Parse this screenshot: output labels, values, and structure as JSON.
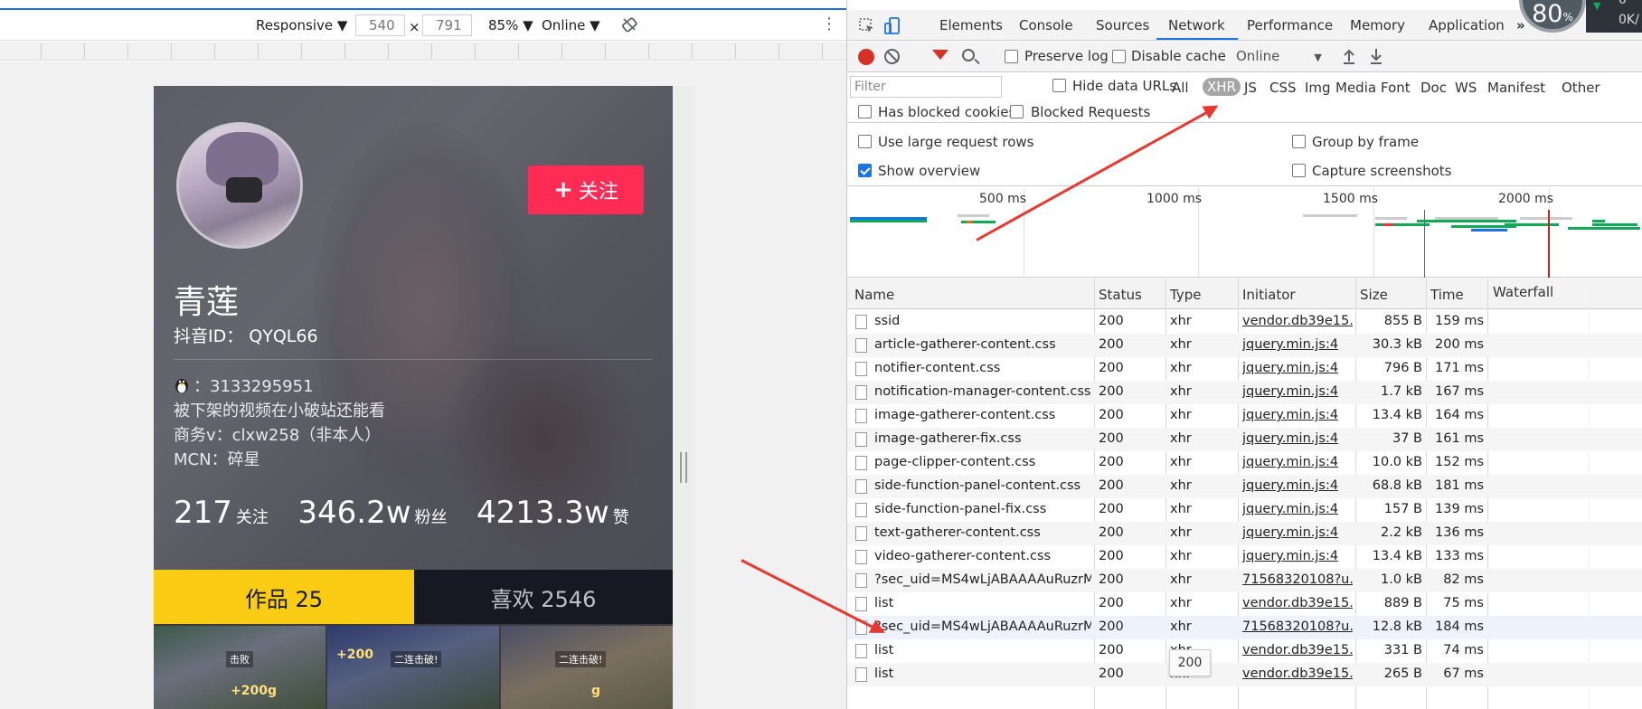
{
  "device_toolbar": {
    "mode": "Responsive",
    "width": "540",
    "height": "791",
    "times": "×",
    "zoom": "85%",
    "network": "Online"
  },
  "profile": {
    "follow_label": "关注",
    "nickname": "青莲",
    "douyin_id": "抖音ID：  QYQL66",
    "bio": {
      "qq": "：3133295951",
      "line2": "被下架的视频在小破站还能看",
      "line3": "商务v：clxw258（非本人）",
      "line4": "MCN：碎星"
    },
    "stats": {
      "following_num": "217",
      "following_label": "关注",
      "fans_num": "346.2w",
      "fans_label": "粉丝",
      "likes_num": "4213.3w",
      "likes_label": "赞"
    },
    "tabs": {
      "works": "作品 25",
      "likes": "喜欢 2546"
    },
    "thumbs": [
      {
        "label": "击败",
        "gold": "+200g"
      },
      {
        "label": "二连击破!",
        "gold": "+200"
      },
      {
        "label": "二连击破!",
        "gold": "g"
      }
    ]
  },
  "devtools": {
    "tabs": [
      "Elements",
      "Console",
      "Sources",
      "Network",
      "Performance",
      "Memory",
      "Application"
    ],
    "more": "»",
    "network_toolbar": {
      "preserve_log": "Preserve log",
      "disable_cache": "Disable cache",
      "throttle": "Online"
    },
    "filter": {
      "placeholder": "Filter",
      "hide_data_urls": "Hide data URLs",
      "types": [
        "All",
        "XHR",
        "JS",
        "CSS",
        "Img",
        "Media",
        "Font",
        "Doc",
        "WS",
        "Manifest",
        "Other"
      ],
      "active_type": "XHR",
      "has_blocked_cookies": "Has blocked cookies",
      "blocked_requests": "Blocked Requests"
    },
    "settings": {
      "large_rows": "Use large request rows",
      "group_by_frame": "Group by frame",
      "show_overview": "Show overview",
      "capture_screenshots": "Capture screenshots"
    },
    "overview": {
      "ticks": [
        "500 ms",
        "1000 ms",
        "1500 ms",
        "2000 ms"
      ]
    },
    "columns": [
      "Name",
      "Status",
      "Type",
      "Initiator",
      "Size",
      "Time",
      "Waterfall"
    ],
    "requests": [
      {
        "name": "ssid",
        "status": "200",
        "type": "xhr",
        "initiator": "vendor.db39e15...",
        "size": "855 B",
        "time": "159 ms"
      },
      {
        "name": "article-gatherer-content.css",
        "status": "200",
        "type": "xhr",
        "initiator": "jquery.min.js:4",
        "size": "30.3 kB",
        "time": "200 ms"
      },
      {
        "name": "notifier-content.css",
        "status": "200",
        "type": "xhr",
        "initiator": "jquery.min.js:4",
        "size": "796 B",
        "time": "171 ms"
      },
      {
        "name": "notification-manager-content.css",
        "status": "200",
        "type": "xhr",
        "initiator": "jquery.min.js:4",
        "size": "1.7 kB",
        "time": "167 ms"
      },
      {
        "name": "image-gatherer-content.css",
        "status": "200",
        "type": "xhr",
        "initiator": "jquery.min.js:4",
        "size": "13.4 kB",
        "time": "164 ms"
      },
      {
        "name": "image-gatherer-fix.css",
        "status": "200",
        "type": "xhr",
        "initiator": "jquery.min.js:4",
        "size": "37 B",
        "time": "161 ms"
      },
      {
        "name": "page-clipper-content.css",
        "status": "200",
        "type": "xhr",
        "initiator": "jquery.min.js:4",
        "size": "10.0 kB",
        "time": "152 ms"
      },
      {
        "name": "side-function-panel-content.css",
        "status": "200",
        "type": "xhr",
        "initiator": "jquery.min.js:4",
        "size": "68.8 kB",
        "time": "181 ms"
      },
      {
        "name": "side-function-panel-fix.css",
        "status": "200",
        "type": "xhr",
        "initiator": "jquery.min.js:4",
        "size": "157 B",
        "time": "139 ms"
      },
      {
        "name": "text-gatherer-content.css",
        "status": "200",
        "type": "xhr",
        "initiator": "jquery.min.js:4",
        "size": "2.2 kB",
        "time": "136 ms"
      },
      {
        "name": "video-gatherer-content.css",
        "status": "200",
        "type": "xhr",
        "initiator": "jquery.min.js:4",
        "size": "13.4 kB",
        "time": "133 ms"
      },
      {
        "name": "?sec_uid=MS4wLjABAAAAuRuzrM...",
        "status": "200",
        "type": "xhr",
        "initiator": "71568320108?u...",
        "size": "1.0 kB",
        "time": "82 ms"
      },
      {
        "name": "list",
        "status": "200",
        "type": "xhr",
        "initiator": "vendor.db39e15...",
        "size": "889 B",
        "time": "75 ms"
      },
      {
        "name": "?sec_uid=MS4wLjABAAAAuRuzrM...",
        "status": "200",
        "type": "xhr",
        "initiator": "71568320108?u...",
        "size": "12.8 kB",
        "time": "184 ms"
      },
      {
        "name": "list",
        "status": "200",
        "type": "xhr",
        "initiator": "vendor.db39e15...",
        "size": "331 B",
        "time": "74 ms"
      },
      {
        "name": "list",
        "status": "200",
        "type": "xhr",
        "initiator": "vendor.db39e15...",
        "size": "265 B",
        "time": "67 ms"
      }
    ],
    "tooltip": "200",
    "perf_badge": {
      "value": "80",
      "unit": "%",
      "side_top": "0",
      "side_bottom": "0K/"
    }
  },
  "colors": {
    "accent": "#1a73e8",
    "follow": "#fe2c55",
    "works_tab": "#facd14",
    "record": "#d93025",
    "annotation_arrow": "#e8382f"
  }
}
